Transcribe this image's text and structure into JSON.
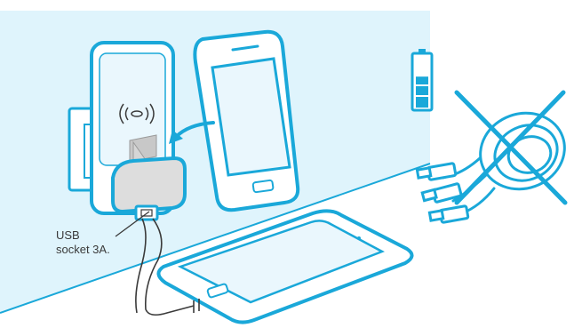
{
  "callout": {
    "line1": "USB",
    "line2": "socket 3A."
  },
  "colors": {
    "accent": "#1aa8d9",
    "wall": "#dff4fc",
    "screen": "#eaf7fd",
    "stroke_text": "#3a3a3a",
    "battery_fill": "#1aa8d9"
  },
  "battery": {
    "level": 0.6
  },
  "icons": [
    "wireless-charging-icon",
    "battery-icon",
    "cable-crossed-icon",
    "charge-arrow-icon"
  ]
}
